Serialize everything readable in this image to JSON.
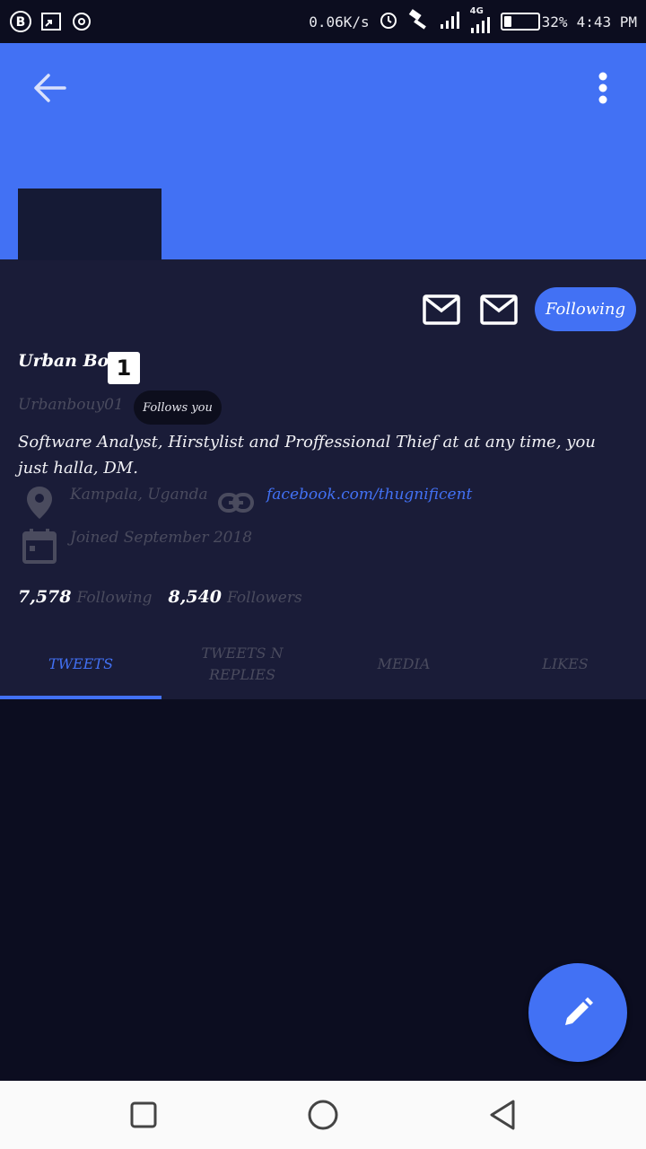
{
  "status_bar": {
    "net_speed": "0.06K/s",
    "network": "4G",
    "battery_percent": 32,
    "battery_label": "32%",
    "time": "4:43 PM",
    "icons": [
      "b-app-icon",
      "screen-cast-icon",
      "sync-icon",
      "alarm-icon",
      "hammer-icon",
      "signal-icon",
      "signal-4g-icon",
      "battery-icon"
    ]
  },
  "header": {
    "back_icon": "arrow-left-icon",
    "menu_icon": "more-vertical-icon",
    "banner_color": "#4271f4"
  },
  "actions": {
    "message_icon": "mail-icon",
    "following_label": "Following"
  },
  "profile": {
    "name": "Urban Boy",
    "badge": "1",
    "handle": "Urbanbouy01",
    "follows_you": "Follows you",
    "bio": "Software Analyst, Hirstylist and Proffessional Thief at at any time, you just halla, DM.",
    "location": "Kampala, Uganda",
    "link": "facebook.com/thugnificent",
    "joined": "Joined September 2018",
    "following_count": "7,578",
    "following_label": "Following",
    "followers_count": "8,540",
    "followers_label": "Followers"
  },
  "tabs": [
    {
      "label": "TWEETS",
      "active": true
    },
    {
      "label": "TWEETS N REPLIES",
      "active": false
    },
    {
      "label": "MEDIA",
      "active": false
    },
    {
      "label": "LIKES",
      "active": false
    }
  ],
  "fab": {
    "icon": "pencil-icon"
  },
  "nav_bar": {
    "icons": [
      "recent-apps-icon",
      "home-icon",
      "back-icon"
    ]
  },
  "colors": {
    "accent": "#4271f4",
    "background": "#1a1c38",
    "muted_text": "#4a4b5e"
  }
}
